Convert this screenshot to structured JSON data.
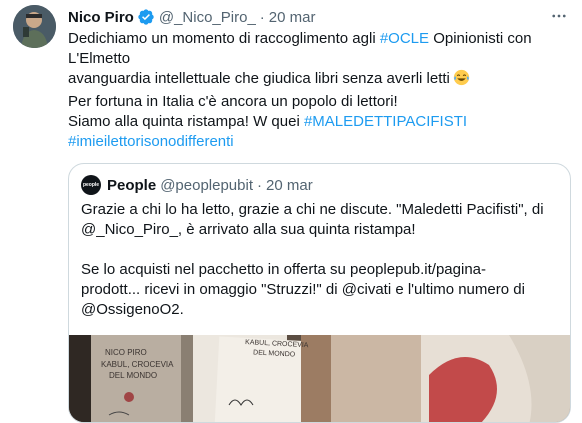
{
  "tweet": {
    "author_name": "Nico Piro",
    "author_handle": "@_Nico_Piro_",
    "separator": "·",
    "date": "20 mar",
    "text_lines": [
      {
        "parts": [
          {
            "t": "Dedichiamo un momento di raccoglimento agli ",
            "tag": false
          },
          {
            "t": "#OCLE",
            "tag": true
          },
          {
            "t": " Opinionisti con",
            "tag": false
          }
        ]
      },
      {
        "parts": [
          {
            "t": "L'Elmetto",
            "tag": false
          }
        ]
      },
      {
        "parts": [
          {
            "t": "avanguardia intellettuale che giudica libri senza averli letti",
            "tag": false
          }
        ]
      },
      {
        "parts": [
          {
            "t": "Per fortuna in Italia c'è ancora un popolo di lettori!",
            "tag": false
          }
        ]
      },
      {
        "parts": [
          {
            "t": "Siamo alla quinta ristampa! W quei ",
            "tag": false
          },
          {
            "t": "#MALEDETTIPACIFISTI",
            "tag": true
          }
        ]
      },
      {
        "parts": [
          {
            "t": "#imieilettorisonodifferenti",
            "tag": true
          }
        ]
      }
    ],
    "emoji": "laughing-tears-emoji",
    "colors": {
      "link": "#1d9bf0",
      "verified": "#1d9bf0",
      "muted": "#536471"
    }
  },
  "quote": {
    "avatar_text": "people",
    "author_name": "People",
    "author_handle": "@peoplepubit",
    "separator": "·",
    "date": "20 mar",
    "text_lines": [
      "Grazie a chi lo ha letto, grazie a chi ne discute. \"Maledetti Pacifisti\", di",
      "@_Nico_Piro_, è arrivato alla sua quinta ristampa!",
      "",
      "Se lo acquisti nel pacchetto in offerta su  peoplepub.it/pagina-",
      "prodott... ricevi in omaggio \"Struzzi!\" di @civati e l'ultimo numero di",
      "@OssigenoO2."
    ],
    "media": {
      "book_author": "NICO PIRO",
      "book_title_1": "KABUL, CROCEVIA",
      "book_title_2": "DEL MONDO",
      "book_spine_1": "KABUL, CROCEVIA",
      "book_spine_2": "DEL MONDO"
    }
  }
}
